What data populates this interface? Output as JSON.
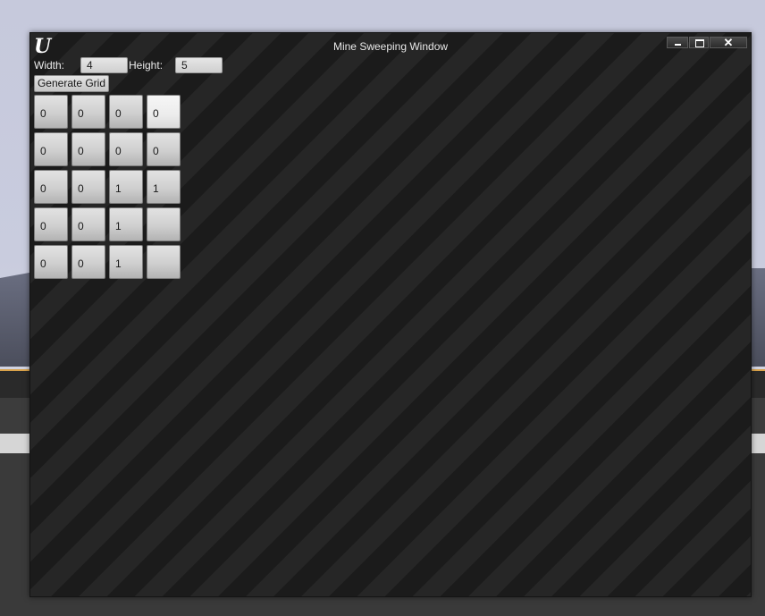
{
  "window": {
    "title": "Mine Sweeping Window",
    "logo_text": "U",
    "close_glyph": "✕"
  },
  "form": {
    "width_label": "Width:",
    "width_value": "4",
    "height_label": "Height:",
    "height_value": "5",
    "generate_label": "Generate Grid"
  },
  "grid": {
    "rows": [
      [
        "0",
        "0",
        "0",
        "0"
      ],
      [
        "0",
        "0",
        "0",
        "0"
      ],
      [
        "0",
        "0",
        "1",
        "1"
      ],
      [
        "0",
        "0",
        "1",
        ""
      ],
      [
        "0",
        "0",
        "1",
        ""
      ]
    ],
    "selected_cell": [
      0,
      3
    ]
  }
}
